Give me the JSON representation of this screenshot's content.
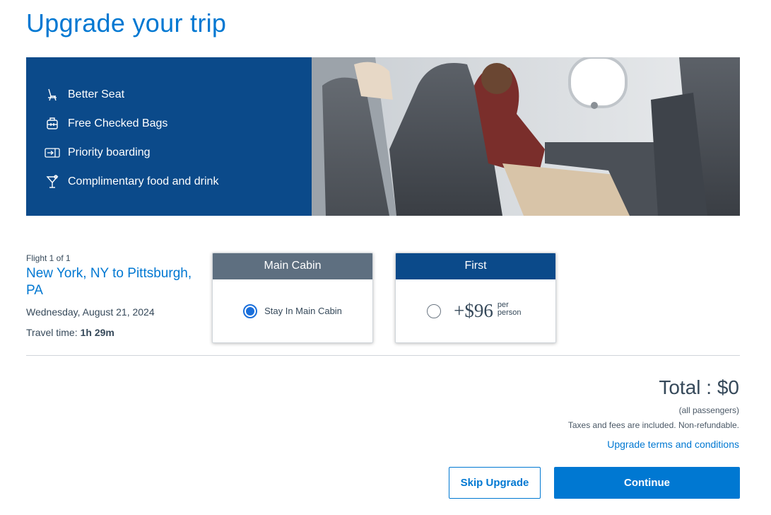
{
  "page": {
    "title": "Upgrade your trip"
  },
  "benefits": [
    {
      "label": "Better Seat",
      "icon": "seat-icon"
    },
    {
      "label": "Free Checked Bags",
      "icon": "luggage-icon"
    },
    {
      "label": "Priority boarding",
      "icon": "boarding-pass-icon"
    },
    {
      "label": "Complimentary food and drink",
      "icon": "cocktail-icon"
    }
  ],
  "flight": {
    "count": "Flight 1 of 1",
    "route": "New York, NY to Pittsburgh, PA",
    "date": "Wednesday, August 21, 2024",
    "travel_time_label": "Travel time:",
    "travel_time_value": "1h 29m"
  },
  "cabins": {
    "main": {
      "header": "Main Cabin",
      "option_label": "Stay In Main Cabin",
      "selected": true
    },
    "first": {
      "header": "First",
      "price": "+$96",
      "per_person": "per person",
      "selected": false
    }
  },
  "summary": {
    "total": "Total : $0",
    "all_passengers": "(all passengers)",
    "taxes_note": "Taxes and fees are included. Non-refundable.",
    "terms_link": "Upgrade terms and conditions"
  },
  "actions": {
    "skip_label": "Skip Upgrade",
    "continue_label": "Continue"
  },
  "colors": {
    "brand_blue": "#0078d2",
    "panel_navy": "#0b4a8a",
    "main_cabin_gray": "#5e6f80"
  }
}
